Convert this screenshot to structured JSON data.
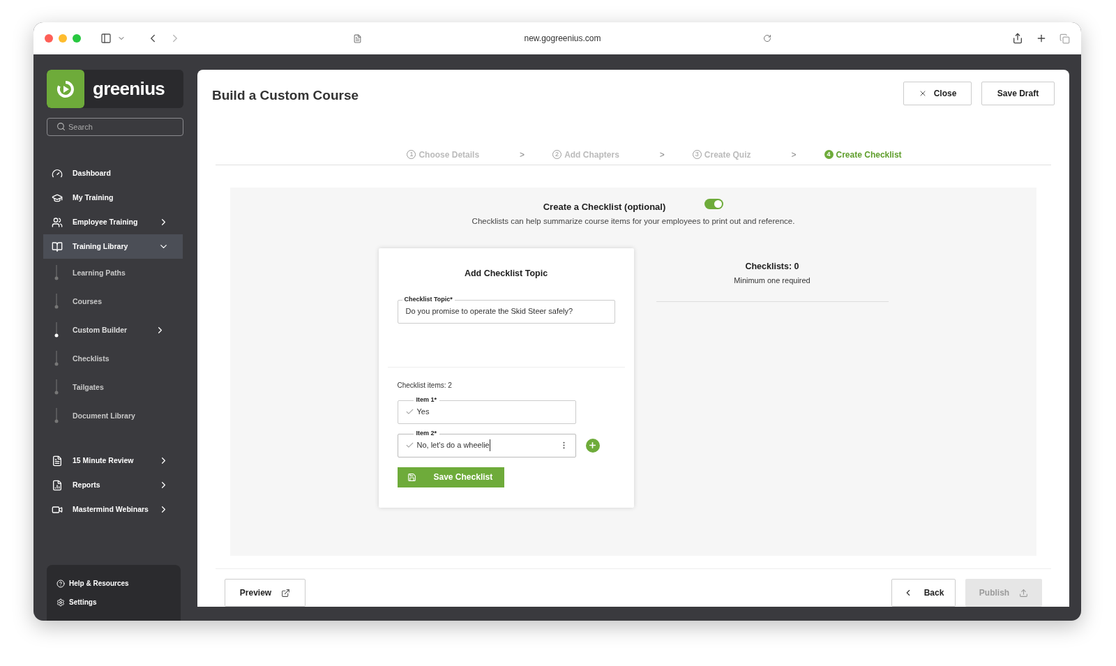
{
  "browser": {
    "url": "new.gogreenius.com"
  },
  "sidebar": {
    "logo": "greenius",
    "search": {
      "placeholder": "Search"
    },
    "items": [
      {
        "label": "Dashboard",
        "selected": false,
        "chevron": false
      },
      {
        "label": "My Training",
        "selected": false,
        "chevron": false
      },
      {
        "label": "Employee Training",
        "selected": false,
        "chevron": true
      },
      {
        "label": "Training Library",
        "selected": true,
        "chevron": true,
        "expanded": true,
        "children": [
          {
            "label": "Learning Paths",
            "selected": false,
            "chevron": false
          },
          {
            "label": "Courses",
            "selected": false,
            "chevron": false
          },
          {
            "label": "Custom Builder",
            "selected": true,
            "chevron": true
          },
          {
            "label": "Checklists",
            "selected": false,
            "chevron": false
          },
          {
            "label": "Tailgates",
            "selected": false,
            "chevron": false
          },
          {
            "label": "Document Library",
            "selected": false,
            "chevron": false
          }
        ]
      },
      {
        "label": "15 Minute Review",
        "selected": false,
        "chevron": true
      },
      {
        "label": "Reports",
        "selected": false,
        "chevron": true
      },
      {
        "label": "Mastermind Webinars",
        "selected": false,
        "chevron": true
      }
    ],
    "footer": [
      "Help & Resources",
      "Settings"
    ]
  },
  "header": {
    "title": "Build a Custom Course",
    "buttons": [
      {
        "label": "Close",
        "kind": "close"
      },
      {
        "label": "Save Draft",
        "kind": "plain"
      }
    ]
  },
  "steps": [
    {
      "number": "1",
      "label": "Choose Details",
      "selected": false
    },
    {
      "number": "2",
      "label": "Add Chapters",
      "selected": false
    },
    {
      "number": "3",
      "label": "Create Quiz",
      "selected": false
    },
    {
      "number": "4",
      "label": "Create Checklist",
      "selected": true
    }
  ],
  "step_separator": ">",
  "checklist_section": {
    "title": "Create a Checklist (optional)",
    "on": true,
    "description": "Checklists can help summarize course items for your employees to print out and reference."
  },
  "card": {
    "title": "Add Checklist Topic",
    "topic": {
      "label": "Checklist Topic*",
      "value": "Do you promise to operate the Skid Steer safely?"
    },
    "items_count": "Checklist items: 2",
    "items": [
      {
        "label": "Item 1*",
        "value": "Yes",
        "focused": false
      },
      {
        "label": "Item 2*",
        "value": "No, let's do a wheelie",
        "focused": true
      }
    ],
    "save_button": "Save Checklist"
  },
  "summary": {
    "title": "Checklists: 0",
    "subtitle": "Minimum one required"
  },
  "footer": {
    "preview": "Preview",
    "back": "Back",
    "publish": {
      "label": "Publish",
      "disabled": true
    }
  }
}
